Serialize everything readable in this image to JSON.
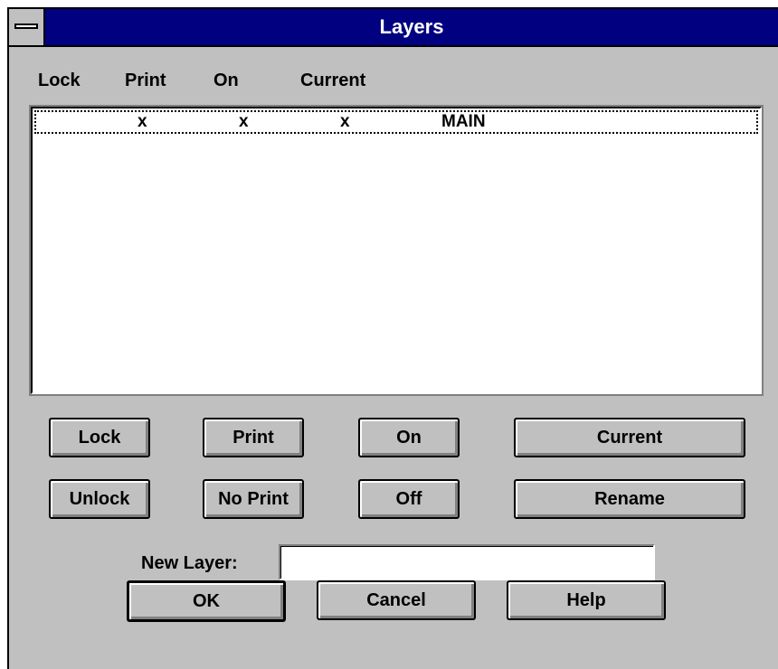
{
  "window": {
    "title": "Layers"
  },
  "columns": [
    "Lock",
    "Print",
    "On",
    "Current"
  ],
  "layers": [
    {
      "lock": "",
      "print": "x",
      "on": "x",
      "current": "x",
      "name": "MAIN"
    }
  ],
  "buttons": {
    "lock": "Lock",
    "print": "Print",
    "on": "On",
    "current": "Current",
    "unlock": "Unlock",
    "no_print": "No Print",
    "off": "Off",
    "rename": "Rename"
  },
  "new_layer": {
    "label": "New Layer:",
    "value": ""
  },
  "dialog_buttons": {
    "ok": "OK",
    "cancel": "Cancel",
    "help": "Help"
  }
}
